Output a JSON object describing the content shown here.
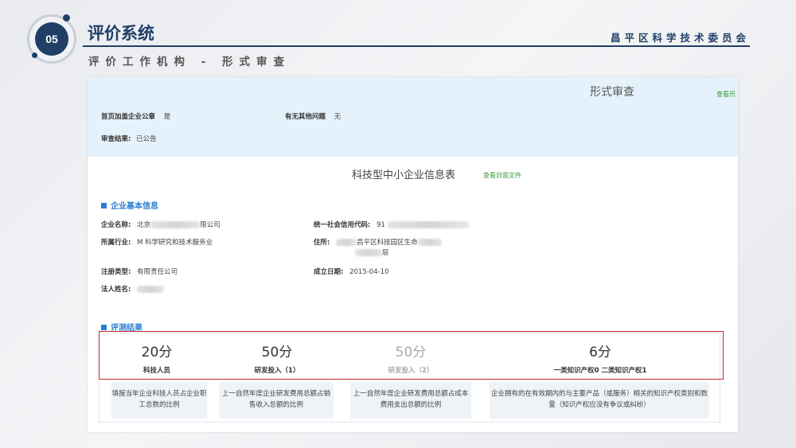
{
  "header": {
    "badge": "05",
    "title": "评价系统",
    "org": "昌平区科学技术委员会",
    "subtitle": "评价工作机构 - 形式审查"
  },
  "review": {
    "title": "形式审查",
    "history_link": "查看历",
    "stamp_label": "首页加盖企业公章",
    "stamp_value": "是",
    "other_label": "有无其他问题",
    "other_value": "无",
    "result_label": "审查结果:",
    "result_value": "已公告"
  },
  "form": {
    "title": "科技型中小企业信息表",
    "cover_link": "查看封面文件"
  },
  "basic": {
    "section": "企业基本信息",
    "name_label": "企业名称:",
    "name_prefix": "北京",
    "name_suffix": "限公司",
    "credit_label": "统一社会信用代码:",
    "credit_prefix": "91",
    "industry_label": "所属行业:",
    "industry_value": "M 科学研究和技术服务业",
    "address_label": "住所:",
    "address_mid": "昌平区科技园区生命",
    "address_line2": "层",
    "reg_label": "注册类型:",
    "reg_value": "有限责任公司",
    "date_label": "成立日期:",
    "date_value": "2015-04-10",
    "legal_label": "法人姓名:"
  },
  "evaluation": {
    "section": "评测结果",
    "scores": [
      {
        "value": "20分",
        "name": "科技人员",
        "desc": "填报当年企业科技人员占企业职工总数的比例"
      },
      {
        "value": "50分",
        "name": "研发投入（1）",
        "desc": "上一自然年度企业研发费用总额占销售收入总额的比例"
      },
      {
        "value": "50分",
        "name": "研发投入（2）",
        "desc": "上一自然年度企业研发费用总额占成本费用支出总额的比例"
      },
      {
        "value": "6分",
        "name": "一类知识产权0  二类知识产权1",
        "desc": "企业拥有的在有效期内的与主要产品（或服务）相关的知识产权类别和数量（知识产权应没有争议或纠纷）"
      }
    ]
  },
  "colors": {
    "navy": "#1f3f66",
    "accent_blue": "#2a7fd1",
    "link_green": "#3a9a3a",
    "highlight_red": "#c62828",
    "band": "#e6f2fb"
  }
}
